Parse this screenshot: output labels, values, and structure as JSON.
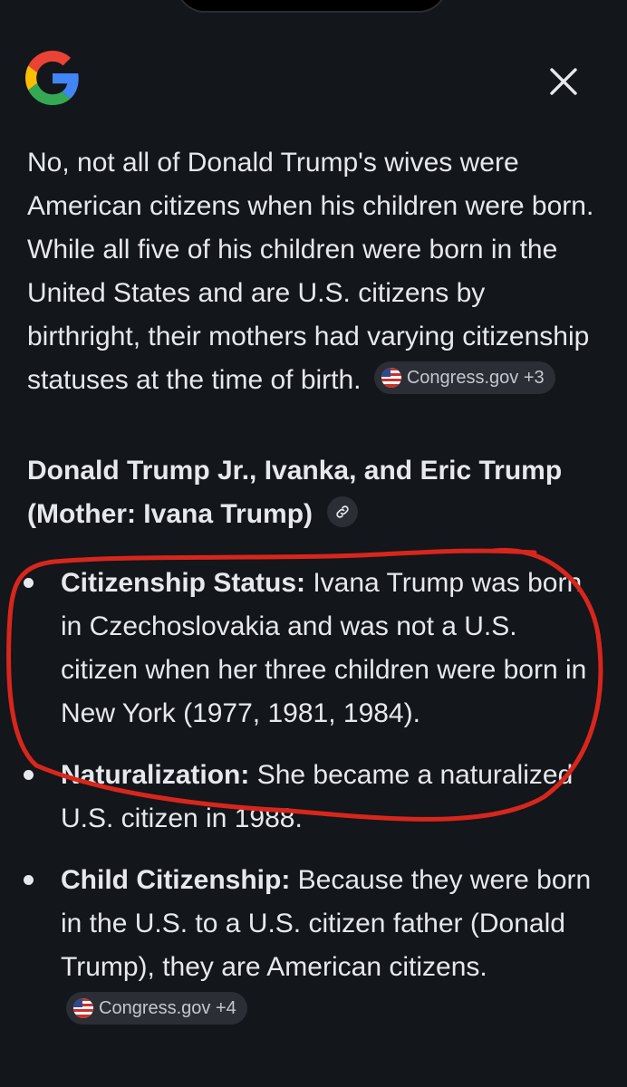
{
  "header": {
    "logo_name": "google-g-logo",
    "close_icon": "close-icon"
  },
  "answer": {
    "intro": "No, not all of Donald Trump's wives were American citizens when his children were born. While all five of his children were born in the United States and are U.S. citizens by birthright, their mothers had varying citizenship statuses at the time of birth.",
    "intro_source": "Congress.gov +3",
    "section_heading": "Donald Trump Jr., Ivanka, and Eric Trump (Mother: Ivana Trump)",
    "bullets": [
      {
        "label": "Citizenship Status:",
        "text": " Ivana Trump was born in Czechoslovakia and was not a U.S. citizen when her three children were born in New York (1977, 1981, 1984)."
      },
      {
        "label": "Naturalization:",
        "text": " She became a naturalized U.S. citizen in 1988."
      },
      {
        "label": "Child Citizenship:",
        "text": " Because they were born in the U.S. to a U.S. citizen father (Donald Trump), they are American citizens."
      }
    ],
    "bullet_source": "Congress.gov +4"
  },
  "colors": {
    "background": "#13161b",
    "text": "#e6e8ec",
    "chip": "#2b2e35",
    "annotation": "#d8261c"
  }
}
